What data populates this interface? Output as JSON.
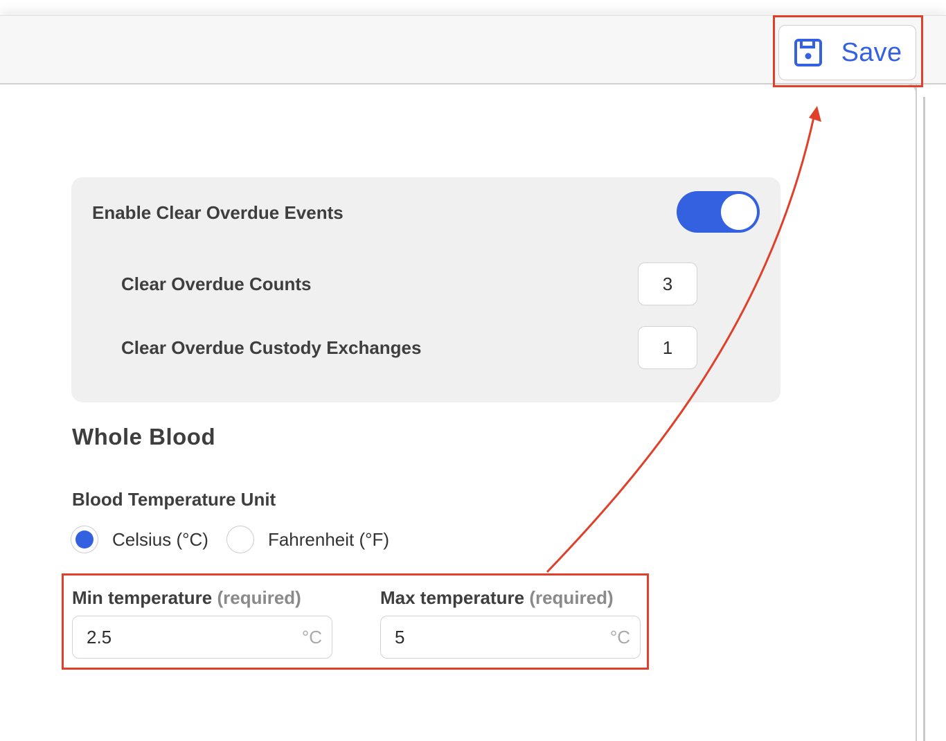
{
  "toolbar": {
    "save_label": "Save"
  },
  "overdue_panel": {
    "title": "Enable Clear Overdue Events",
    "toggle_enabled": true,
    "counts_label": "Clear Overdue Counts",
    "counts_value": "3",
    "custody_label": "Clear Overdue Custody Exchanges",
    "custody_value": "1"
  },
  "whole_blood": {
    "heading": "Whole Blood",
    "unit_label": "Blood Temperature Unit",
    "options": [
      {
        "label": "Celsius (°C)",
        "selected": true
      },
      {
        "label": "Fahrenheit (°F)",
        "selected": false
      }
    ],
    "min_temp": {
      "label": "Min temperature",
      "required": "(required)",
      "value": "2.5",
      "unit": "°C"
    },
    "max_temp": {
      "label": "Max temperature",
      "required": "(required)",
      "value": "5",
      "unit": "°C"
    }
  },
  "colors": {
    "accent": "#3461e0",
    "annotation": "#e0402a",
    "panel_bg": "#f0f0f0"
  },
  "icons": {
    "save": "floppy-disk-icon"
  }
}
